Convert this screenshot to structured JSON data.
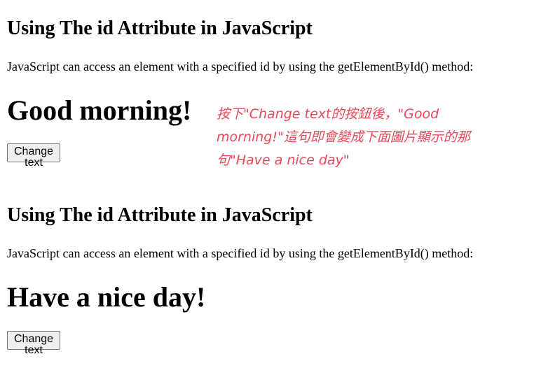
{
  "demo_before": {
    "heading": "Using The id Attribute in JavaScript",
    "description": "JavaScript can access an element with a specified id by using the getElementById() method:",
    "greeting": "Good morning!",
    "button_label": "Change text"
  },
  "annotation": {
    "line1": "按下\"Change text的按鈕後，\"Good",
    "line2": "morning!\"這句即會變成下面圖片顯示的那",
    "line3": "句\"Have a nice day\"",
    "color": "#e8485a"
  },
  "demo_after": {
    "heading": "Using The id Attribute in JavaScript",
    "description": "JavaScript can access an element with a specified id by using the getElementById() method:",
    "greeting": "Have a nice day!",
    "button_label": "Change text"
  }
}
